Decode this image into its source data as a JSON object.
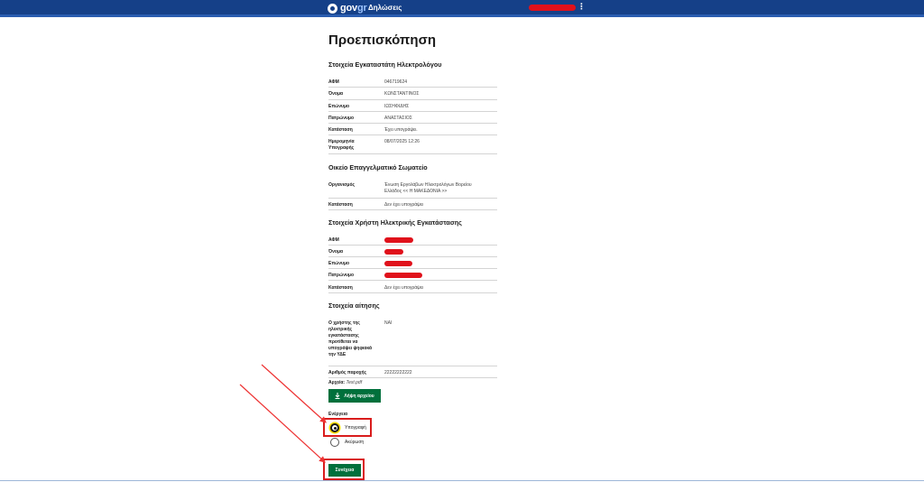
{
  "header": {
    "logo_gov": "gov",
    "logo_gr": "gr",
    "service": "Δηλώσεις",
    "menu_icon": "⋮"
  },
  "page": {
    "title": "Προεπισκόπηση"
  },
  "installer": {
    "title": "Στοιχεία Εγκαταστάτη Ηλεκτρολόγου",
    "rows": [
      {
        "k": "ΑΦΜ",
        "v": "046719624"
      },
      {
        "k": "Όνομα",
        "v": "ΚΩΝΣΤΑΝΤΙΝΟΣ"
      },
      {
        "k": "Επώνυμο",
        "v": "ΙΩΣΗΦΙΔΗΣ"
      },
      {
        "k": "Πατρώνυμο",
        "v": "ΑΝΑΣΤΑΣΙΟΣ"
      },
      {
        "k": "Κατάσταση",
        "v": "Έχει υπογράψει."
      },
      {
        "k": "Ημερομηνία Υπογραφής",
        "v": "08/07/2025 12:26"
      }
    ]
  },
  "association": {
    "title": "Οικείο Επαγγελματικό Σωματείο",
    "rows": [
      {
        "k": "Οργανισμός",
        "v": "Ένωση Εργολάβων Ηλεκτρολόγων Βορείου Ελλάδος << Η ΜΑΚΕΔΟΝΙΑ >>"
      },
      {
        "k": "Κατάσταση",
        "v": "Δεν έχει υπογράψει"
      }
    ]
  },
  "user": {
    "title": "Στοιχεία Χρήστη Ηλεκτρικής Εγκατάστασης",
    "rows": [
      {
        "k": "ΑΦΜ"
      },
      {
        "k": "Όνομα"
      },
      {
        "k": "Επώνυμο"
      },
      {
        "k": "Πατρώνυμο"
      },
      {
        "k": "Κατάσταση",
        "v": "Δεν έχει υπογράψει"
      }
    ]
  },
  "application": {
    "title": "Στοιχεία αίτησης",
    "rows": [
      {
        "k": "Ο χρήστης της ηλεκτρικής εγκατάστασης προτίθεται να υπογράψει ψηφιακά την ΥΔΕ",
        "v": "ΝΑΙ"
      },
      {
        "k": "Αριθμός παροχής",
        "v": "22222222222"
      }
    ],
    "files_label": "Αρχεία:",
    "files_value": "Test.pdf",
    "download_label": "Λήψη αρχείου"
  },
  "action": {
    "label": "Ενέργεια",
    "options": [
      {
        "label": "Υπογραφή",
        "checked": true
      },
      {
        "label": "Ακύρωση",
        "checked": false
      }
    ],
    "continue_label": "Συνέχεια"
  },
  "colors": {
    "header": "#154088",
    "primary_button": "#00703c",
    "redaction": "#e0111b",
    "annotation": "#d91c1c"
  },
  "icons": {
    "logo": "govgr-logo-icon",
    "menu": "kebab-menu-icon",
    "download": "download-icon",
    "arrows": "annotation-arrow-icon"
  }
}
